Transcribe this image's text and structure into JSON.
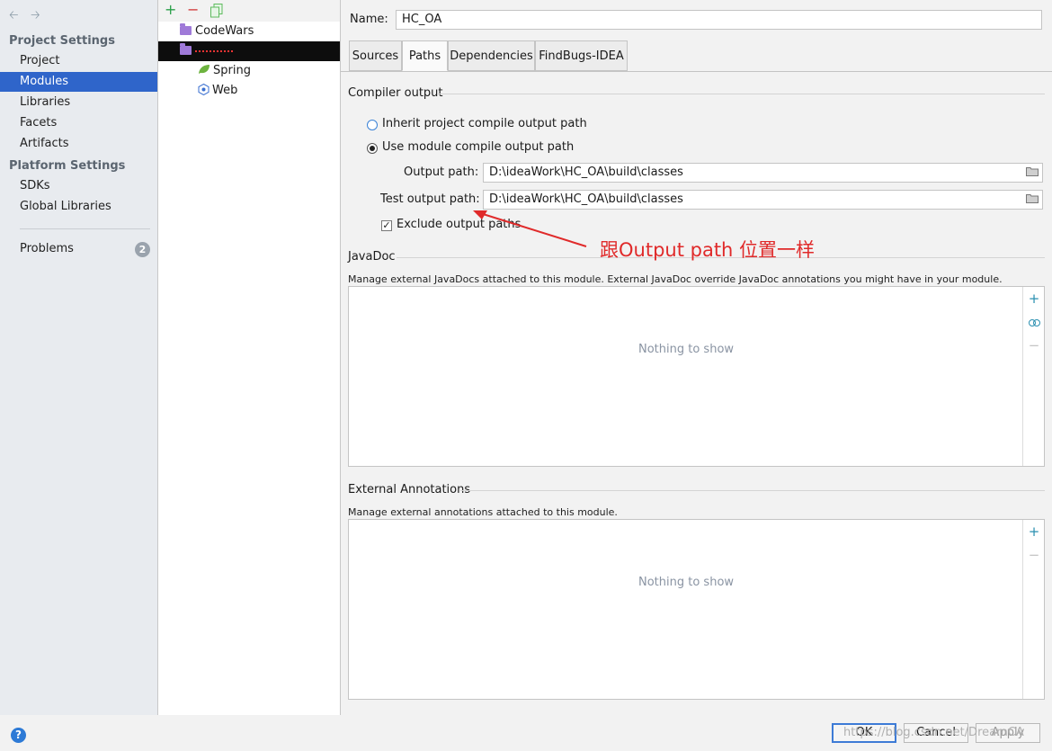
{
  "sidebar": {
    "back_icon": "arrow-left-icon",
    "forward_icon": "arrow-right-icon",
    "project_settings_title": "Project Settings",
    "project_items": [
      "Project",
      "Modules",
      "Libraries",
      "Facets",
      "Artifacts"
    ],
    "platform_settings_title": "Platform Settings",
    "platform_items": [
      "SDKs",
      "Global Libraries"
    ],
    "problems_label": "Problems",
    "problems_count": "2",
    "selected_item": "Modules"
  },
  "tree": {
    "toolbar": {
      "add": "+",
      "remove": "−",
      "copy_icon": "copy-icon"
    },
    "items": [
      {
        "label": "CodeWars",
        "icon": "module-folder-icon"
      },
      {
        "label": "",
        "icon": "module-folder-icon",
        "selected": true
      },
      {
        "label": "Spring",
        "icon": "spring-leaf-icon"
      },
      {
        "label": "Web",
        "icon": "web-icon"
      }
    ]
  },
  "main": {
    "name_label": "Name:",
    "name_value": "HC_OA",
    "tabs": [
      "Sources",
      "Paths",
      "Dependencies",
      "FindBugs-IDEA"
    ],
    "active_tab": "Paths",
    "compiler_output": {
      "title": "Compiler output",
      "inherit_label": "Inherit project compile output path",
      "use_module_label": "Use module compile output path",
      "output_path_label": "Output path:",
      "output_path_value": "D:\\ideaWork\\HC_OA\\build\\classes",
      "test_output_path_label": "Test output path:",
      "test_output_path_value": "D:\\ideaWork\\HC_OA\\build\\classes",
      "exclude_label": "Exclude output paths"
    },
    "javadoc": {
      "title": "JavaDoc",
      "description": "Manage external JavaDocs attached to this module. External JavaDoc override JavaDoc annotations you might have in your module.",
      "empty_text": "Nothing to show",
      "add": "+",
      "link_icon": "link-icon",
      "remove": "−"
    },
    "external_annotations": {
      "title": "External Annotations",
      "description": "Manage external annotations attached to this module.",
      "empty_text": "Nothing to show",
      "add": "+",
      "remove": "−"
    }
  },
  "annotation": {
    "text": "跟Output path 位置一样",
    "color": "#e02a2a"
  },
  "bottom": {
    "help": "?",
    "ok": "OK",
    "cancel": "Cancel",
    "apply": "Apply",
    "watermark": "https://blog.csdn.net/DreamCA"
  },
  "colors": {
    "selection": "#2f65ca",
    "accent": "#3d7bd6"
  }
}
